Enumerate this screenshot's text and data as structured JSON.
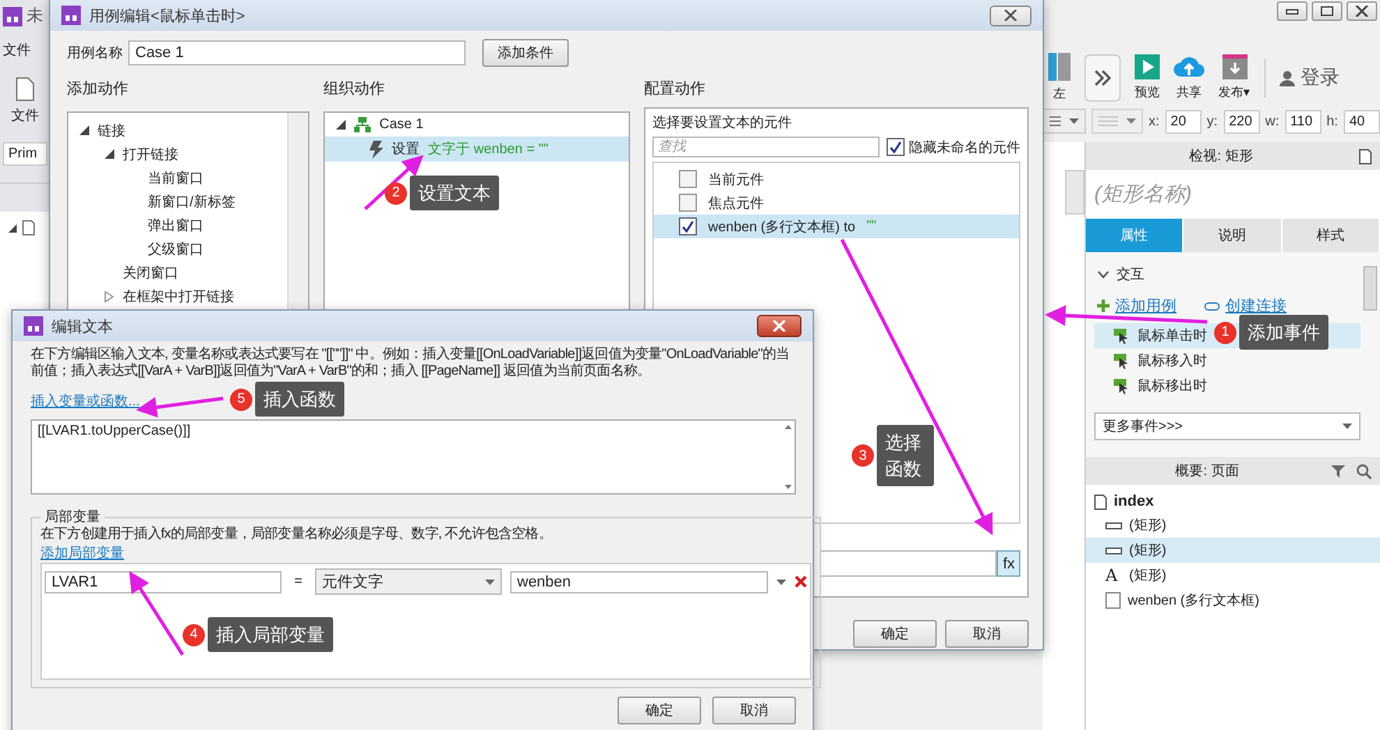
{
  "app": {
    "title": "未",
    "menu": [
      "文件"
    ],
    "file_tool": "文件",
    "style_value": "Prim",
    "toolbar": [
      {
        "kind": "align",
        "label": "左"
      },
      {
        "kind": "more"
      },
      {
        "kind": "preview",
        "label": "预览"
      },
      {
        "kind": "share",
        "label": "共享"
      },
      {
        "kind": "publish",
        "label": "发布▾"
      }
    ],
    "login": "登录",
    "geometry": [
      {
        "label": "x:",
        "value": "20"
      },
      {
        "label": "y:",
        "value": "220"
      },
      {
        "label": "w:",
        "value": "110"
      },
      {
        "label": "h:",
        "value": "40"
      }
    ],
    "inspector": {
      "title": "检视: 矩形",
      "name_placeholder": "(矩形名称)",
      "tabs": [
        {
          "label": "属性",
          "selected": true
        },
        {
          "label": "说明",
          "selected": false
        },
        {
          "label": "样式",
          "selected": false
        }
      ],
      "section": "交互",
      "expanded": true,
      "add_case": "添加用例",
      "create_link": "创建连接",
      "events": [
        {
          "label": "鼠标单击时",
          "selected": true
        },
        {
          "label": "鼠标移入时",
          "selected": false
        },
        {
          "label": "鼠标移出时",
          "selected": false
        }
      ],
      "more_events": "更多事件>>>"
    },
    "outline": {
      "title": "概要: 页面",
      "root": "index",
      "items": [
        {
          "kind": "shape",
          "label": "(矩形)",
          "selected": false
        },
        {
          "kind": "shape",
          "label": "(矩形)",
          "selected": true
        },
        {
          "kind": "text",
          "glyph": "A",
          "label": "(矩形)",
          "selected": false
        },
        {
          "kind": "textarea",
          "label": "wenben (多行文本框)",
          "selected": false
        }
      ]
    }
  },
  "case_editor": {
    "title": "用例编辑<鼠标单击时>",
    "name_label": "用例名称",
    "name_value": "Case 1",
    "add_condition": "添加条件",
    "add_actions": {
      "heading": "添加动作",
      "tree": [
        {
          "label": "链接",
          "expanded": true,
          "children": [
            {
              "label": "打开链接",
              "expanded": true,
              "children": [
                {
                  "label": "当前窗口"
                },
                {
                  "label": "新窗口/新标签"
                },
                {
                  "label": "弹出窗口"
                },
                {
                  "label": "父级窗口"
                }
              ]
            },
            {
              "label": "关闭窗口"
            },
            {
              "label": "在框架中打开链接",
              "expanded": false
            }
          ]
        }
      ]
    },
    "organize": {
      "heading": "组织动作",
      "case": "Case 1",
      "action": {
        "verb": "设置",
        "detail": "文字于 wenben = \"\"",
        "selected": true
      }
    },
    "configure": {
      "heading": "配置动作",
      "prompt": "选择要设置文本的元件",
      "search_placeholder": "查找",
      "hide_unnamed": {
        "label": "隐藏未命名的元件",
        "checked": true
      },
      "widgets": [
        {
          "label": "当前元件",
          "checked": false,
          "selected": false
        },
        {
          "label": "焦点元件",
          "checked": false,
          "selected": false
        },
        {
          "label": "wenben (多行文本框) to",
          "value": "\"\"",
          "checked": true,
          "selected": true
        }
      ],
      "fx": "fx"
    },
    "buttons": [
      "确定",
      "取消"
    ]
  },
  "edit_text": {
    "title": "编辑文本",
    "description": "在下方编辑区输入文本, 变量名称或表达式要写在 \"[[\"\"]]\" 中。例如：插入变量[[OnLoadVariable]]返回值为变量\"OnLoadVariable\"的当前值；插入表达式[[VarA + VarB]]返回值为\"VarA + VarB\"的和；插入 [[PageName]] 返回值为当前页面名称。",
    "insert_link": "插入变量或函数...",
    "text": "[[LVAR1.toUpperCase()]]",
    "locals": {
      "legend": "局部变量",
      "description": "在下方创建用于插入fx的局部变量，局部变量名称必须是字母、数字, 不允许包含空格。",
      "add_link": "添加局部变量",
      "rows": [
        {
          "name": "LVAR1",
          "operator": "=",
          "type": "元件文字",
          "target": "wenben"
        }
      ]
    },
    "buttons": [
      "确定",
      "取消"
    ]
  },
  "annotations": [
    {
      "number": "2",
      "text": "设置文本"
    },
    {
      "number": "1",
      "text": "添加事件"
    },
    {
      "number": "5",
      "text": "插入函数"
    },
    {
      "number": "3",
      "text": "选择函数"
    },
    {
      "number": "4",
      "text": "插入局部变量"
    }
  ]
}
